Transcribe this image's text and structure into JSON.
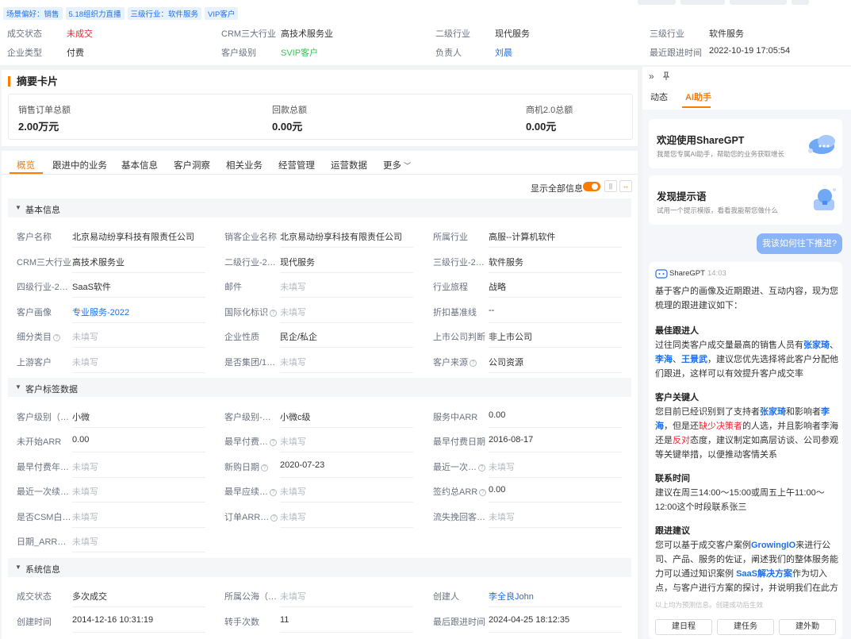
{
  "header": {
    "tags": [
      "场景偏好：销售",
      "5.18组织力直播",
      "三级行业：软件服务",
      "VIP客户"
    ],
    "meta": [
      {
        "label": "成交状态",
        "value": "未成交"
      },
      {
        "label": "CRM三大行业",
        "value": "高技术服务业"
      },
      {
        "label": "二级行业",
        "value": "现代服务"
      },
      {
        "label": "三级行业",
        "value": "软件服务"
      },
      {
        "label": "企业类型",
        "value": "付费"
      },
      {
        "label": "客户级别",
        "value": "SVIP客户"
      },
      {
        "label": "负责人",
        "value": "刘晨"
      },
      {
        "label": "最近跟进时间",
        "value": "2022-10-19 17:05:54"
      }
    ]
  },
  "summary": {
    "title": "摘要卡片",
    "items": [
      {
        "label": "销售订单总额",
        "value": "2.00万元"
      },
      {
        "label": "回款总额",
        "value": "0.00元"
      },
      {
        "label": "商机2.0总额",
        "value": "0.00元"
      }
    ]
  },
  "tabs": [
    "概览",
    "跟进中的业务",
    "基本信息",
    "客户洞察",
    "相关业务",
    "经营管理",
    "运营数据",
    "更多"
  ],
  "toolbar": {
    "show_all": "显示全部信息"
  },
  "sections": [
    {
      "title": "基本信息",
      "fields": [
        {
          "label": "客户名称",
          "value": "北京易动纷享科技有限责任公司"
        },
        {
          "label": "销客企业名称",
          "value": "北京易动纷享科技有限责任公司"
        },
        {
          "label": "所属行业",
          "value": "高服--计算机软件"
        },
        {
          "label": "CRM三大行业",
          "value": "高技术服务业"
        },
        {
          "label": "二级行业-2…",
          "value": "现代服务"
        },
        {
          "label": "三级行业-2…",
          "value": "软件服务"
        },
        {
          "label": "四级行业-2…",
          "value": "SaaS软件"
        },
        {
          "label": "邮件",
          "value": "未填写"
        },
        {
          "label": "行业旅程",
          "value": "战略"
        },
        {
          "label": "客户画像",
          "value": "专业服务-2022"
        },
        {
          "label": "国际化标识",
          "value": "未填写"
        },
        {
          "label": "折扣基准线",
          "value": "--"
        },
        {
          "label": "细分类目",
          "value": "未填写"
        },
        {
          "label": "企业性质",
          "value": "民企/私企"
        },
        {
          "label": "上市公司判断",
          "value": "非上市公司"
        },
        {
          "label": "上游客户",
          "value": "未填写"
        },
        {
          "label": "是否集团/1…",
          "value": "未填写"
        },
        {
          "label": "客户来源",
          "value": "公司资源"
        }
      ]
    },
    {
      "title": "客户标签数据",
      "fields": [
        {
          "label": "客户级别（…",
          "value": "小微"
        },
        {
          "label": "客户级别-…",
          "value": "小微c级"
        },
        {
          "label": "服务中ARR",
          "value": "0.00"
        },
        {
          "label": "未开始ARR",
          "value": "0.00"
        },
        {
          "label": "最早付费…",
          "value": "未填写"
        },
        {
          "label": "最早付费日期",
          "value": "2016-08-17"
        },
        {
          "label": "最早付费年…",
          "value": "未填写"
        },
        {
          "label": "新购日期",
          "value": "2020-07-23"
        },
        {
          "label": "最近一次…",
          "value": "未填写"
        },
        {
          "label": "最近一次续…",
          "value": "未填写"
        },
        {
          "label": "最早应续…",
          "value": "未填写"
        },
        {
          "label": "签约总ARR",
          "value": "0.00"
        },
        {
          "label": "是否CSM白…",
          "value": "未填写"
        },
        {
          "label": "订单ARR…",
          "value": "未填写"
        },
        {
          "label": "流失挽回客…",
          "value": "未填写"
        },
        {
          "label": "日期_ARR…",
          "value": "未填写"
        }
      ]
    },
    {
      "title": "系统信息",
      "fields": [
        {
          "label": "成交状态",
          "value": "多次成交"
        },
        {
          "label": "所属公海（…",
          "value": "未填写"
        },
        {
          "label": "创建人",
          "value": "李全良John"
        },
        {
          "label": "创建时间",
          "value": "2014-12-16 10:31:19"
        },
        {
          "label": "转手次数",
          "value": "11"
        },
        {
          "label": "最后跟进时间",
          "value": "2024-04-25 18:12:35"
        }
      ]
    }
  ],
  "assistant": {
    "tabs": [
      "动态",
      "AI助手"
    ],
    "cards": [
      {
        "title": "欢迎使用ShareGPT",
        "subtitle": "我是您专属AI助手，帮助您的业务获取增长"
      },
      {
        "title": "发现提示语",
        "subtitle": "试用一个提示模版，看看我能帮您做什么"
      }
    ],
    "user_msg": "我该如何往下推进?",
    "bot_name": "ShareGPT",
    "bot_time": "14:03",
    "intro": "基于客户的画像及近期跟进、互动内容，现为您梳理的跟进建议如下：",
    "h1": "最佳跟进人",
    "h2": "客户关键人",
    "h3": "联系时间",
    "p3": "建议在周三14:00～15:00或周五上午11:00～12:00这个时段联系张三",
    "h4": "跟进建议",
    "footer": "以上均为预测信息。创建成功后生效",
    "buttons": [
      "建日程",
      "建任务",
      "建外勤"
    ]
  }
}
